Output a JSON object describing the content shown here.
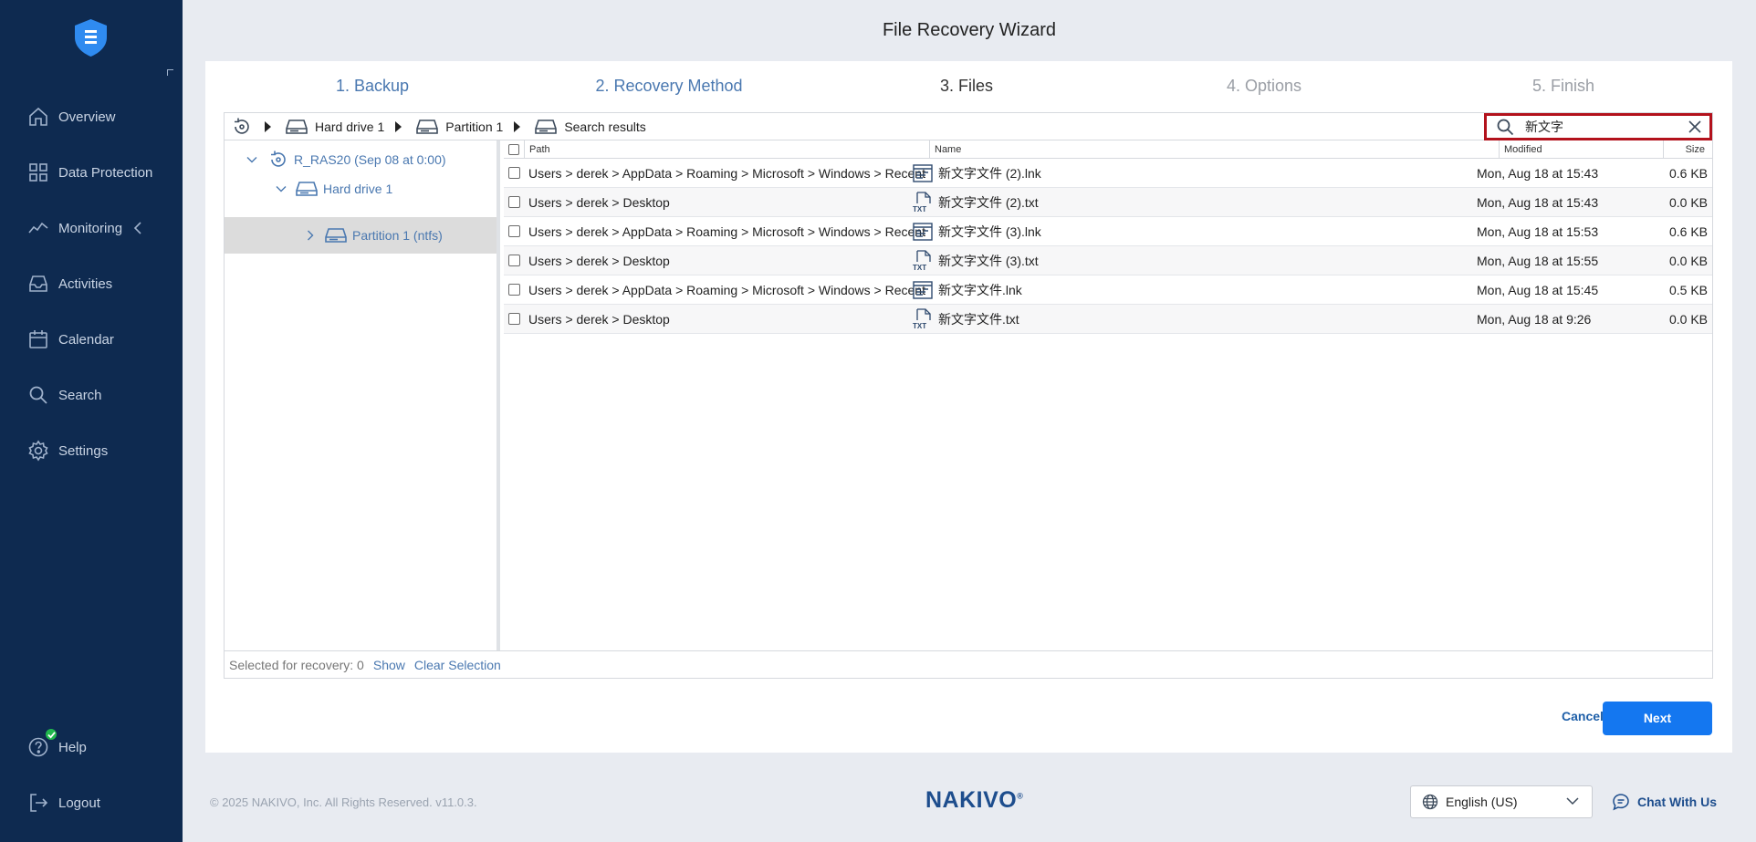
{
  "colors": {
    "sidebar": "#0e2a50",
    "accent": "#1477f0",
    "link": "#4a78b0",
    "search_border": "#b3121c",
    "help_badge": "#20b74d"
  },
  "sidebar": {
    "items": [
      {
        "label": "Overview",
        "icon": "home-icon"
      },
      {
        "label": "Data Protection",
        "icon": "grid-icon"
      },
      {
        "label": "Monitoring",
        "icon": "pulse-icon"
      },
      {
        "label": "Activities",
        "icon": "inbox-icon"
      },
      {
        "label": "Calendar",
        "icon": "calendar-icon"
      },
      {
        "label": "Search",
        "icon": "search-icon"
      },
      {
        "label": "Settings",
        "icon": "gear-icon"
      }
    ],
    "help": "Help",
    "logout": "Logout"
  },
  "wizard": {
    "title": "File Recovery Wizard",
    "steps": [
      "1. Backup",
      "2. Recovery Method",
      "3. Files",
      "4. Options",
      "5. Finish"
    ],
    "active_step": 3
  },
  "breadcrumb": [
    "Hard drive 1",
    "Partition 1",
    "Search results"
  ],
  "search": {
    "value": "新文字"
  },
  "tree": [
    {
      "label": "R_RAS20 (Sep 08 at 0:00)",
      "expanded": true
    },
    {
      "label": "Hard drive 1",
      "expanded": true
    },
    {
      "label": "Partition 1 (ntfs)",
      "expanded": false,
      "selected": true
    }
  ],
  "table": {
    "headers": [
      "Path",
      "Name",
      "Modified",
      "Size"
    ],
    "rows": [
      {
        "path": "Users > derek > AppData > Roaming > Microsoft > Windows > Recent",
        "name": "新文字文件 (2).lnk",
        "type": "lnk",
        "modified": "Mon, Aug 18 at 15:43",
        "size": "0.6 KB"
      },
      {
        "path": "Users > derek > Desktop",
        "name": "新文字文件 (2).txt",
        "type": "txt",
        "modified": "Mon, Aug 18 at 15:43",
        "size": "0.0 KB"
      },
      {
        "path": "Users > derek > AppData > Roaming > Microsoft > Windows > Recent",
        "name": "新文字文件 (3).lnk",
        "type": "lnk",
        "modified": "Mon, Aug 18 at 15:53",
        "size": "0.6 KB"
      },
      {
        "path": "Users > derek > Desktop",
        "name": "新文字文件 (3).txt",
        "type": "txt",
        "modified": "Mon, Aug 18 at 15:55",
        "size": "0.0 KB"
      },
      {
        "path": "Users > derek > AppData > Roaming > Microsoft > Windows > Recent",
        "name": "新文字文件.lnk",
        "type": "lnk",
        "modified": "Mon, Aug 18 at 15:45",
        "size": "0.5 KB"
      },
      {
        "path": "Users > derek > Desktop",
        "name": "新文字文件.txt",
        "type": "txt",
        "modified": "Mon, Aug 18 at 9:26",
        "size": "0.0 KB"
      }
    ]
  },
  "selection": {
    "label": "Selected for recovery: 0",
    "show": "Show",
    "clear": "Clear Selection"
  },
  "buttons": {
    "cancel": "Cancel",
    "next": "Next"
  },
  "footer": {
    "copyright": "© 2025 NAKIVO, Inc. All Rights Reserved. v11.0.3.",
    "brand": "NAKIVO",
    "brand_mark": "®",
    "language": "English (US)",
    "chat": "Chat With Us"
  }
}
